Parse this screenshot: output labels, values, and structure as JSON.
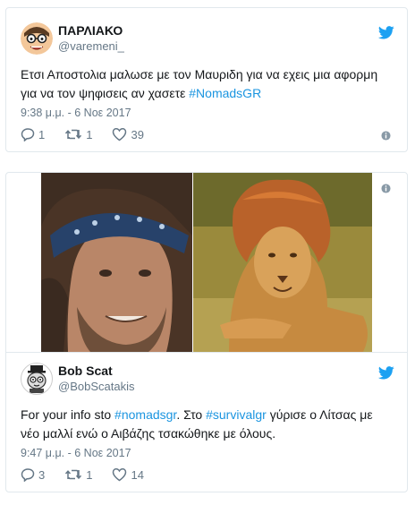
{
  "tweet1": {
    "display_name": "ΠΑΡΛΙΑΚΟ",
    "handle": "@varemeni_",
    "text_before": "Ετσι Αποστολια μαλωσε με τον Μαυριδη για να εχεις μια αφορμη για να τον ψηφισεις αν χασετε ",
    "hashtag": "#NomadsGR",
    "timestamp": "9:38 μ.μ. - 6 Νοε 2017",
    "replies": "1",
    "retweets": "1",
    "likes": "39"
  },
  "tweet2": {
    "display_name": "Bob Scat",
    "handle": "@BobScatakis",
    "text_1": "For your info sto ",
    "hashtag_1": "#nomadsgr",
    "text_2": ". Στο ",
    "hashtag_2": "#survivalgr",
    "text_3": " γύρισε ο Λίτσας με νέο μαλλί ενώ ο Αιβάζης τσακώθηκε με όλους.",
    "timestamp": "9:47 μ.μ. - 6 Νοε 2017",
    "replies": "3",
    "retweets": "1",
    "likes": "14"
  },
  "colors": {
    "link": "#1b95e0",
    "twitter_bird": "#1da1f2",
    "meta_text": "#657786",
    "border": "#e1e8ed"
  },
  "icons": [
    "twitter-bird-icon",
    "reply-icon",
    "retweet-icon",
    "like-heart-icon",
    "info-icon"
  ]
}
